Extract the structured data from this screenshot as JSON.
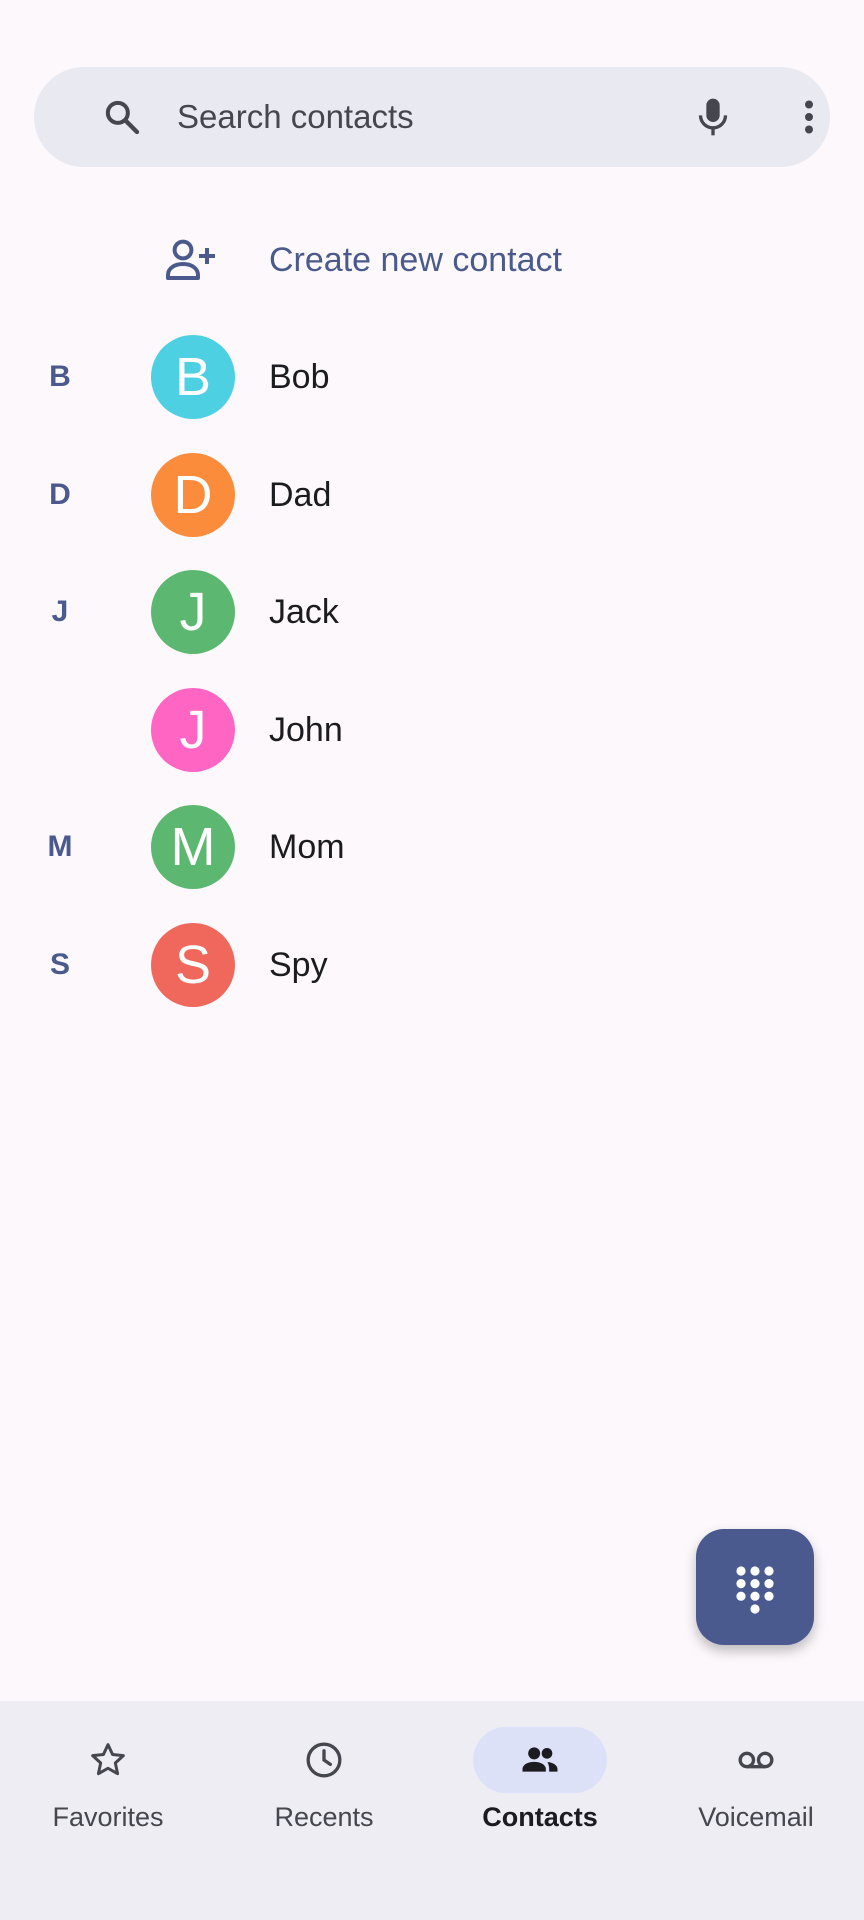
{
  "search": {
    "placeholder": "Search contacts",
    "icon": "search-icon",
    "mic_icon": "mic-icon",
    "more_icon": "more-vert-icon"
  },
  "create_contact": {
    "label": "Create new contact",
    "icon": "person-add-icon"
  },
  "contacts": [
    {
      "section": "B",
      "initial": "B",
      "name": "Bob",
      "color": "#4dd0e1"
    },
    {
      "section": "D",
      "initial": "D",
      "name": "Dad",
      "color": "#fb8c3c"
    },
    {
      "section": "J",
      "initial": "J",
      "name": "Jack",
      "color": "#5cb870"
    },
    {
      "section": "",
      "initial": "J",
      "name": "John",
      "color": "#ff66c4"
    },
    {
      "section": "M",
      "initial": "M",
      "name": "Mom",
      "color": "#5cb870"
    },
    {
      "section": "S",
      "initial": "S",
      "name": "Spy",
      "color": "#f0675c"
    }
  ],
  "fab": {
    "icon": "dialpad-icon"
  },
  "nav": {
    "items": [
      {
        "label": "Favorites",
        "icon": "star-icon"
      },
      {
        "label": "Recents",
        "icon": "clock-icon"
      },
      {
        "label": "Contacts",
        "icon": "people-icon",
        "active": true
      },
      {
        "label": "Voicemail",
        "icon": "voicemail-icon"
      }
    ]
  },
  "colors": {
    "accent": "#4a5a8c",
    "background": "#fcf8fc",
    "search_bg": "#e9e9f1",
    "nav_bg": "#eeedf4",
    "nav_active_pill": "#dce1f7",
    "fab_bg": "#4a5a8f"
  }
}
